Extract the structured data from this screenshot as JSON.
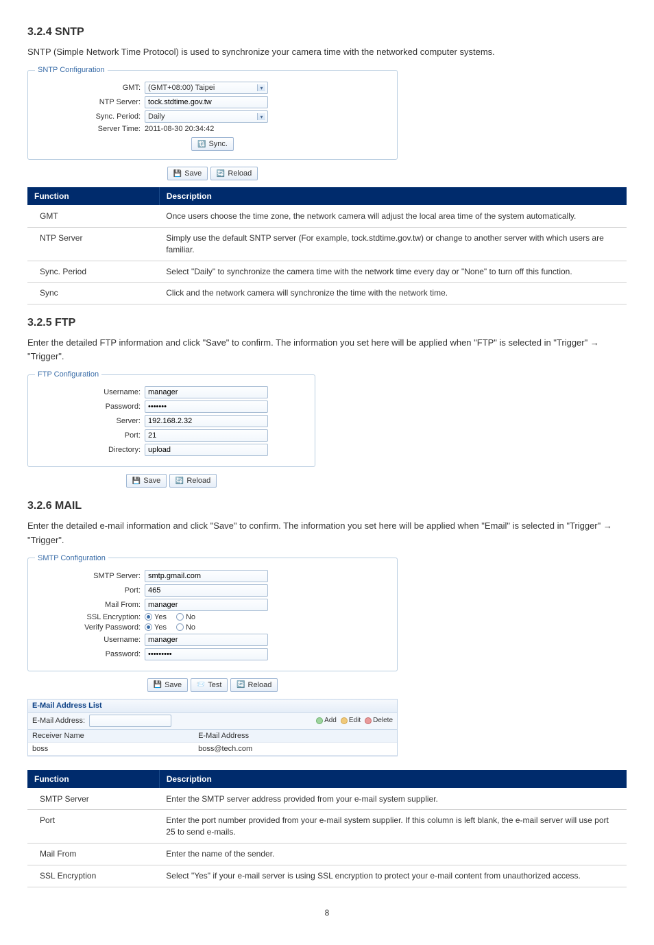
{
  "sntp": {
    "heading": "3.2.4 SNTP",
    "intro": "SNTP (Simple Network Time Protocol) is used to synchronize your camera time with the networked computer systems.",
    "legend": "SNTP Configuration",
    "labels": {
      "gmt": "GMT:",
      "ntp": "NTP Server:",
      "period": "Sync. Period:",
      "servertime": "Server Time:"
    },
    "values": {
      "gmt": "(GMT+08:00) Taipei",
      "ntp": "tock.stdtime.gov.tw",
      "period": "Daily",
      "servertime": "2011-08-30 20:34:42"
    },
    "buttons": {
      "sync": "Sync.",
      "save": "Save",
      "reload": "Reload"
    },
    "table": {
      "h1": "Function",
      "h2": "Description",
      "rows": [
        {
          "f": "GMT",
          "d": "Once users choose the time zone, the network camera will adjust the local area time of the system automatically."
        },
        {
          "f": "NTP Server",
          "d": "Simply use the default SNTP server (For example, tock.stdtime.gov.tw) or change to another server with which users are familiar."
        },
        {
          "f": "Sync. Period",
          "d": "Select \"Daily\" to synchronize the camera time with the network time every day or \"None\" to turn off this function."
        },
        {
          "f": "Sync",
          "d": "Click and the network camera will synchronize the time with the network time."
        }
      ]
    }
  },
  "ftp": {
    "heading": "3.2.5 FTP",
    "intro": "Enter the detailed FTP information and click \"Save\" to confirm. The information you set here will be applied when \"FTP\" is selected in \"Trigger\"  →  \"Trigger\".",
    "legend": "FTP Configuration",
    "labels": {
      "user": "Username:",
      "pass": "Password:",
      "server": "Server:",
      "port": "Port:",
      "dir": "Directory:"
    },
    "values": {
      "user": "manager",
      "pass": "•••••••",
      "server": "192.168.2.32",
      "port": "21",
      "dir": "upload"
    },
    "buttons": {
      "save": "Save",
      "reload": "Reload"
    }
  },
  "mail": {
    "heading": "3.2.6 MAIL",
    "intro": "Enter the detailed e-mail information and click \"Save\" to confirm. The information you set here will be applied when \"Email\" is selected in \"Trigger\"  →  \"Trigger\".",
    "legend": "SMTP Configuration",
    "labels": {
      "server": "SMTP Server:",
      "port": "Port:",
      "mailfrom": "Mail From:",
      "ssl": "SSL Encryption:",
      "verify": "Verify Password:",
      "user": "Username:",
      "pass": "Password:",
      "yes": "Yes",
      "no": "No"
    },
    "values": {
      "server": "smtp.gmail.com",
      "port": "465",
      "mailfrom": "manager",
      "user": "manager",
      "pass": "•••••••••"
    },
    "buttons": {
      "save": "Save",
      "test": "Test",
      "reload": "Reload"
    },
    "list": {
      "title": "E-Mail Address List",
      "barlabel": "E-Mail Address:",
      "add": "Add",
      "edit": "Edit",
      "del": "Delete",
      "col1": "Receiver Name",
      "col2": "E-Mail Address",
      "rows": [
        {
          "name": "boss",
          "email": "boss@tech.com"
        }
      ]
    },
    "table": {
      "h1": "Function",
      "h2": "Description",
      "rows": [
        {
          "f": "SMTP Server",
          "d": "Enter the SMTP server address provided from your e-mail system supplier."
        },
        {
          "f": "Port",
          "d": "Enter the port number provided from your e-mail system supplier. If this column is left blank, the e-mail server will use port 25 to send e-mails."
        },
        {
          "f": "Mail From",
          "d": "Enter the name of the sender."
        },
        {
          "f": "SSL Encryption",
          "d": "Select \"Yes\" if your e-mail server is using SSL encryption to protect your e-mail content from unauthorized access."
        }
      ]
    }
  },
  "page": "8"
}
